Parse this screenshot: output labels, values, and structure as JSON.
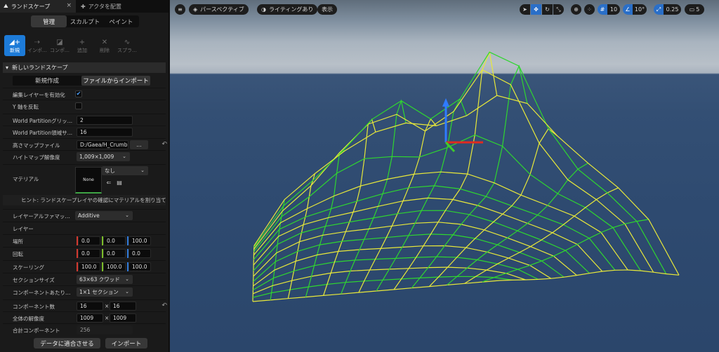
{
  "tabs": [
    {
      "label": "ランドスケープ",
      "close": "×"
    },
    {
      "label": "アクタを配置"
    }
  ],
  "modes": [
    "管理",
    "スカルプト",
    "ペイント"
  ],
  "tools": [
    {
      "label": "新規",
      "icon": "new-landscape-icon"
    },
    {
      "label": "インポ…",
      "icon": "import-icon"
    },
    {
      "label": "コンポ…",
      "icon": "component-icon"
    },
    {
      "label": "追加",
      "icon": "add-icon"
    },
    {
      "label": "削除",
      "icon": "delete-icon"
    },
    {
      "label": "スプラ…",
      "icon": "spline-icon"
    }
  ],
  "section_title": "新しいランドスケープ",
  "subtabs": [
    "新規作成",
    "ファイルからインポート"
  ],
  "props": {
    "edit_layers": {
      "label": "編集レイヤーを有効化",
      "checked": true
    },
    "flip_y": {
      "label": "Y 軸を反転",
      "checked": false
    },
    "wp_grid": {
      "label": "World Partitionグリッ…",
      "value": "2"
    },
    "wp_region": {
      "label": "World Partition領域サ…",
      "value": "16"
    },
    "heightmap_file": {
      "label": "高さマップファイル",
      "value": "D:/Gaea/H_Crumb",
      "browse": "..."
    },
    "heightmap_res": {
      "label": "ハイトマップ解像度",
      "value": "1,009×1,009"
    },
    "material": {
      "label": "マテリアル",
      "thumb": "None",
      "value": "なし"
    },
    "hint": "ヒント: ランドスケープレイヤの確認にマテリアルを割り当て",
    "layer_alpha": {
      "label": "レイヤーアルファマッ…",
      "value": "Additive"
    },
    "layers": {
      "label": "レイヤー"
    },
    "location": {
      "label": "場所",
      "x": "0.0",
      "y": "0.0",
      "z": "100.0"
    },
    "rotation": {
      "label": "回転",
      "x": "0.0",
      "y": "0.0",
      "z": "0.0"
    },
    "scale": {
      "label": "スケーリング",
      "x": "100.0",
      "y": "100.0",
      "z": "100.0"
    },
    "section_size": {
      "label": "セクションサイズ",
      "value": "63×63 クワッド"
    },
    "sections_per_comp": {
      "label": "コンポーネントあたり…",
      "value": "1×1 セクション"
    },
    "component_count": {
      "label": "コンポーネント数",
      "x": "16",
      "sep": "×",
      "y": "16"
    },
    "overall_res": {
      "label": "全体の解像度",
      "x": "1009",
      "sep": "×",
      "y": "1009"
    },
    "total_components": {
      "label": "合計コンポーネント",
      "value": "256"
    }
  },
  "buttons": {
    "fit": "データに適合させる",
    "import": "インポート"
  },
  "viewport": {
    "menu_icon": "hamburger-menu-icon",
    "perspective": "パースペクティブ",
    "lighting": "ライティングあり",
    "show": "表示",
    "grid_snap": "10",
    "rotate_snap": "10°",
    "scale_snap": "0.25",
    "camera_speed": "5"
  },
  "colors": {
    "accent": "#1d7bd8",
    "wire_yellow": "#e8e83a",
    "wire_green": "#2fd62f",
    "gizmo_z": "#2f7bff",
    "gizmo_x": "#e02a1f",
    "gizmo_y": "#3ecb2c"
  }
}
